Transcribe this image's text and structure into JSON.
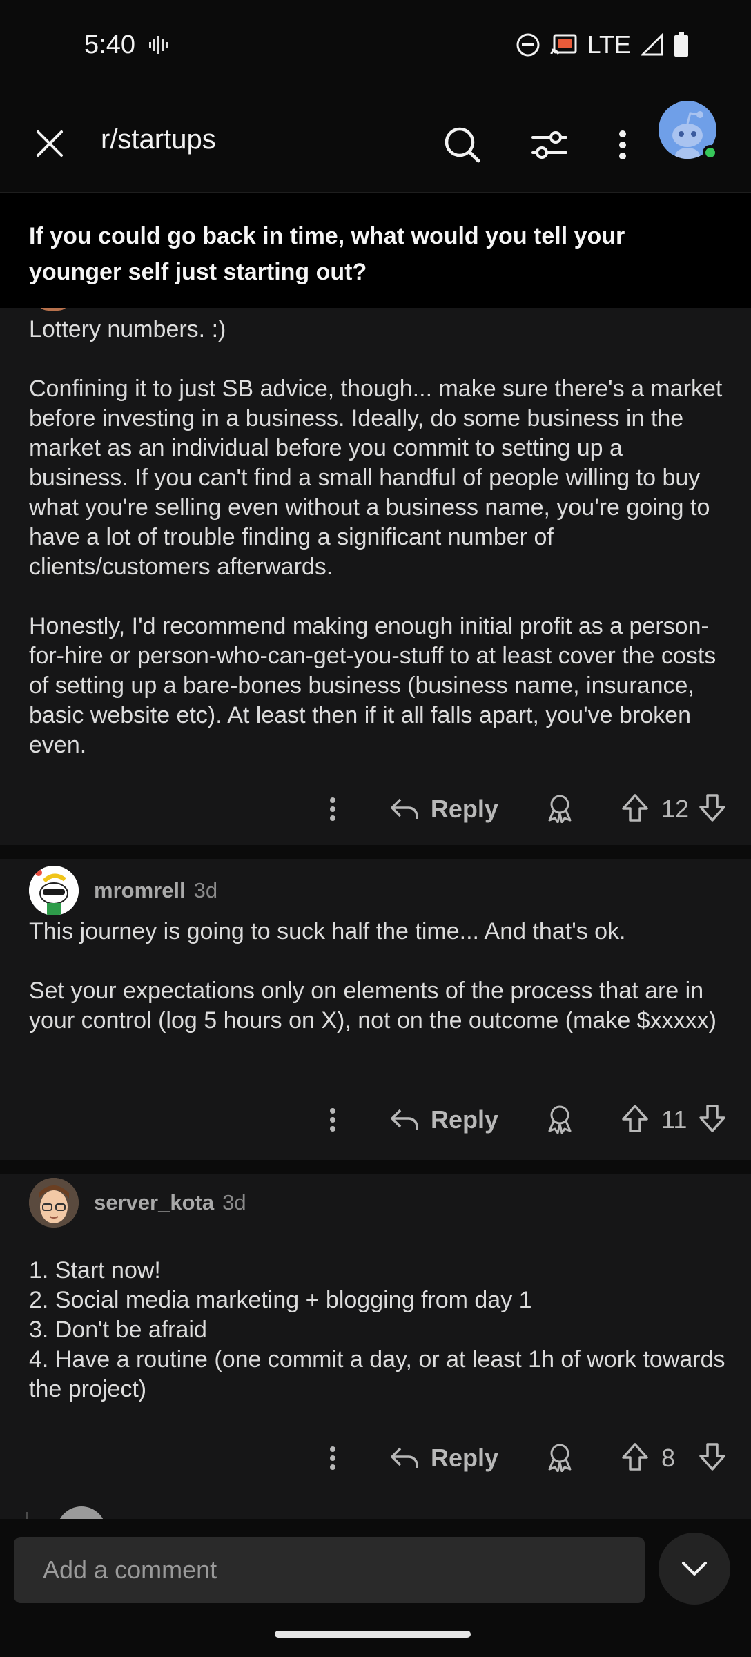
{
  "status_bar": {
    "time": "5:40",
    "network": "LTE"
  },
  "app_bar": {
    "subreddit": "r/startups"
  },
  "post": {
    "title": "If you could go back in time, what would you tell your younger self just starting out?"
  },
  "comments": [
    {
      "paragraphs": [
        "Lottery numbers. :)",
        "Confining it to just SB advice, though... make sure there's a market before investing in a business. Ideally, do some business in the market as an individual before you commit to setting up a business. If you can't find a small handful of people willing to buy what you're selling even without a business name, you're going to have a lot of trouble finding a significant number of clients/customers afterwards.",
        "Honestly, I'd recommend making enough initial profit as a person-for-hire or person-who-can-get-you-stuff to at least cover the costs of setting up a bare-bones business (business name, insurance, basic website etc). At least then if it all falls apart, you've broken even."
      ],
      "reply_label": "Reply",
      "score": "12"
    },
    {
      "username": "mromrell",
      "age": "3d",
      "paragraphs": [
        "This journey is going to suck half the time... And that's ok.",
        "Set your expectations only on elements of the process that are in your control (log 5 hours on X), not on the outcome (make $xxxxx)"
      ],
      "reply_label": "Reply",
      "score": "11"
    },
    {
      "username": "server_kota",
      "age": "3d",
      "paragraphs": [
        "1. Start now!\n2. Social media marketing + blogging from day 1\n3. Don't be afraid\n4. Have a routine (one commit a day, or at least 1h of work towards the project)"
      ],
      "reply_label": "Reply",
      "score": "8"
    }
  ],
  "composer": {
    "placeholder": "Add a comment"
  },
  "icons": {
    "close": "close-icon",
    "search": "search-icon",
    "filter": "sort-filter-icon",
    "more": "more-vertical-icon",
    "reply": "reply-arrow-icon",
    "award": "award-icon",
    "upvote": "upvote-arrow-icon",
    "downvote": "downvote-arrow-icon",
    "collapse": "chevron-down-icon"
  },
  "colors": {
    "background": "#0b0b0b",
    "card": "#161617",
    "online": "#37c75a",
    "avatar": "#6f9fe8"
  }
}
